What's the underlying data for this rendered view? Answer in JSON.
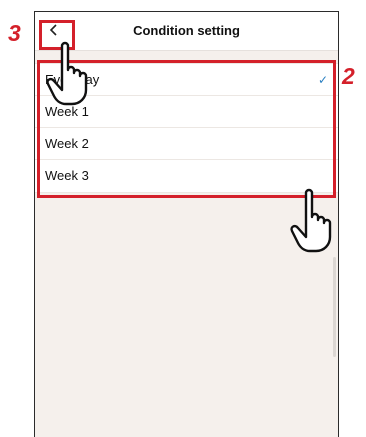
{
  "header": {
    "title": "Condition setting",
    "back_icon": "chevron-left-icon"
  },
  "list": {
    "items": [
      {
        "label": "Everyday",
        "selected": true
      },
      {
        "label": "Week 1",
        "selected": false
      },
      {
        "label": "Week 2",
        "selected": false
      },
      {
        "label": "Week 3",
        "selected": false
      }
    ],
    "check_glyph": "✓"
  },
  "annotations": {
    "back_step": "3",
    "list_step": "2",
    "accent_color": "#d4202a"
  }
}
